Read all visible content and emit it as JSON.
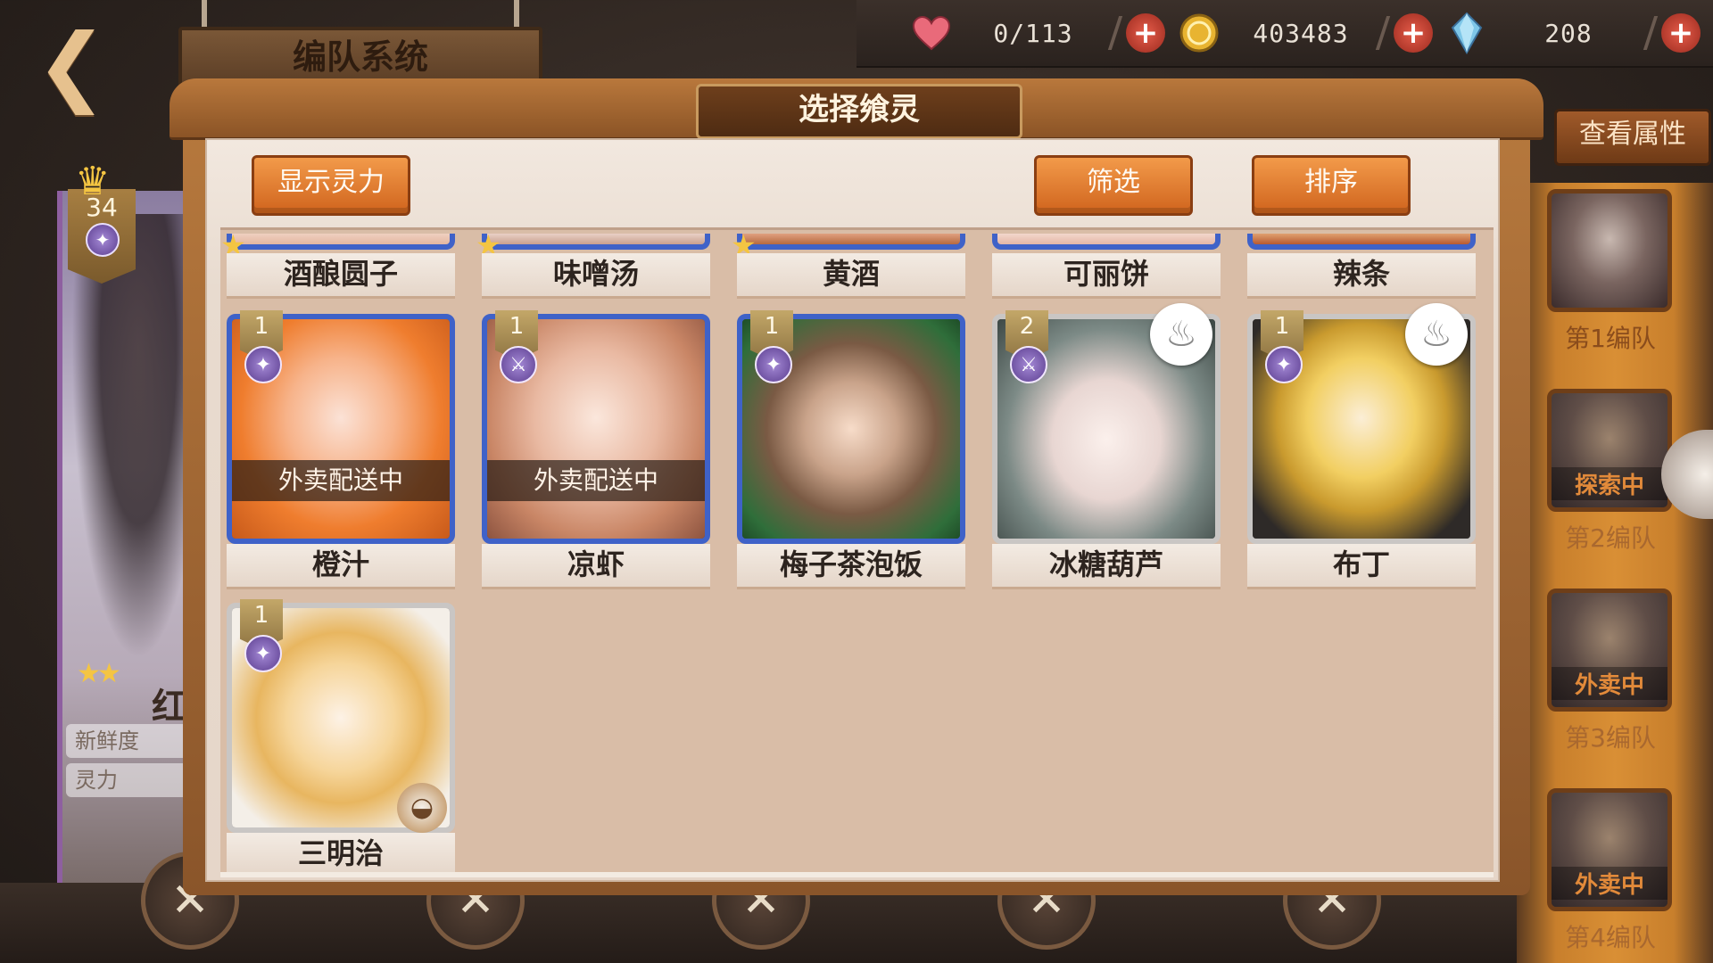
{
  "header": {
    "title": "编队系统",
    "back_icon": "back-arrow-icon"
  },
  "resources": [
    {
      "icon": "heart-icon",
      "value": "0/113"
    },
    {
      "icon": "gold-coin-icon",
      "value": "403483"
    },
    {
      "icon": "crystal-icon",
      "value": "208"
    }
  ],
  "modal": {
    "title": "选择飨灵",
    "show_power_label": "显示灵力",
    "filter_label": "筛选",
    "sort_label": "排序"
  },
  "top_row": [
    "酒酿圆子",
    "味噌汤",
    "黄酒",
    "可丽饼",
    "辣条"
  ],
  "cards": [
    {
      "name": "橙汁",
      "rank": "1",
      "status": "外卖配送中",
      "badge": "star-badge-icon"
    },
    {
      "name": "凉虾",
      "rank": "1",
      "status": "外卖配送中",
      "badge": "sword-badge-icon"
    },
    {
      "name": "梅子茶泡饭",
      "rank": "1",
      "status": "",
      "badge": "star-badge-icon"
    },
    {
      "name": "冰糖葫芦",
      "rank": "2",
      "status": "",
      "badge": "sword-badge-icon",
      "extra": "chef-hat-icon"
    },
    {
      "name": "布丁",
      "rank": "1",
      "status": "",
      "badge": "star-badge-icon",
      "extra": "chef-hat-icon"
    },
    {
      "name": "三明治",
      "rank": "1",
      "status": "",
      "badge": "star-badge-icon",
      "extra": "nest-icon"
    }
  ],
  "left_char": {
    "level": "34",
    "name": "红茶",
    "freshness_label": "新鲜度",
    "power_label": "灵力"
  },
  "sidebar": {
    "view_attr_label": "查看属性",
    "teams": [
      {
        "label": "第1编队",
        "status": ""
      },
      {
        "label": "第2编队",
        "status": "探索中"
      },
      {
        "label": "第3编队",
        "status": "外卖中"
      },
      {
        "label": "第4编队",
        "status": "外卖中"
      }
    ]
  },
  "colors": {
    "accent_orange": "#d0641d",
    "card_blue": "#3f62c8",
    "paper": "#e6d6c9"
  }
}
